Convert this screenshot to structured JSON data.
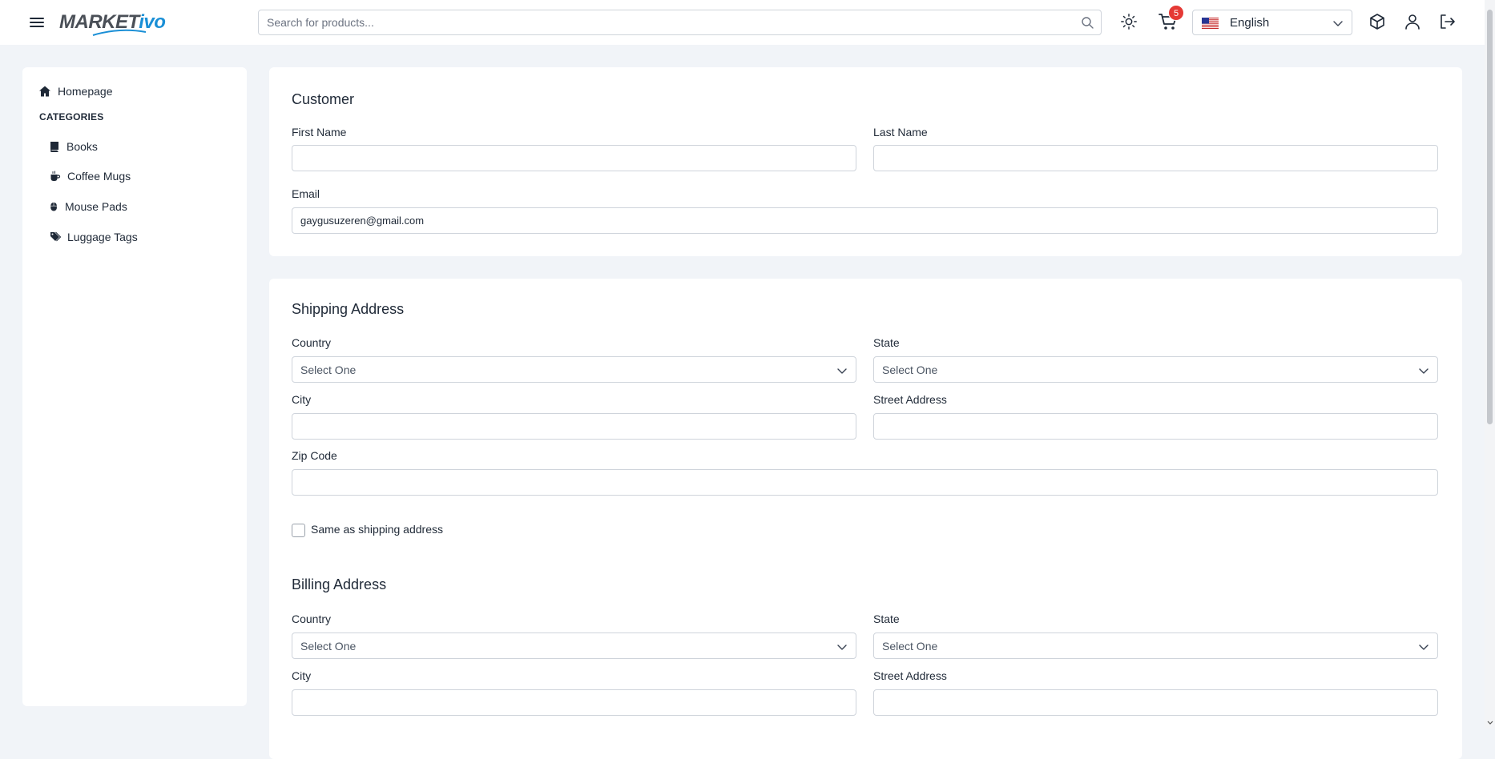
{
  "header": {
    "logo": {
      "part1": "MARKET",
      "part2": "ivo"
    },
    "search": {
      "placeholder": "Search for products..."
    },
    "cart": {
      "badge_count": "5"
    },
    "language": {
      "selected": "English"
    },
    "icons": [
      "menu-icon",
      "search-icon",
      "sun-icon",
      "cart-icon",
      "us-flag-icon",
      "chevron-down-icon",
      "box-icon",
      "user-icon",
      "logout-icon"
    ]
  },
  "sidebar": {
    "home": "Homepage",
    "categories_heading": "CATEGORIES",
    "items": [
      {
        "label": "Books",
        "icon": "book-icon"
      },
      {
        "label": "Coffee Mugs",
        "icon": "mug-icon"
      },
      {
        "label": "Mouse Pads",
        "icon": "mouse-icon"
      },
      {
        "label": "Luggage Tags",
        "icon": "tags-icon"
      }
    ]
  },
  "customer": {
    "title": "Customer",
    "first_name": {
      "label": "First Name",
      "value": ""
    },
    "last_name": {
      "label": "Last Name",
      "value": ""
    },
    "email": {
      "label": "Email",
      "value": "gaygusuzeren@gmail.com"
    }
  },
  "shipping": {
    "title": "Shipping Address",
    "country": {
      "label": "Country",
      "value": "Select One"
    },
    "state": {
      "label": "State",
      "value": "Select One"
    },
    "city": {
      "label": "City",
      "value": ""
    },
    "street": {
      "label": "Street Address",
      "value": ""
    },
    "zip": {
      "label": "Zip Code",
      "value": ""
    },
    "same_checkbox": {
      "label": "Same as shipping address",
      "checked": false
    }
  },
  "billing": {
    "title": "Billing Address",
    "country": {
      "label": "Country",
      "value": "Select One"
    },
    "state": {
      "label": "State",
      "value": "Select One"
    },
    "city": {
      "label": "City",
      "value": ""
    },
    "street": {
      "label": "Street Address",
      "value": ""
    }
  },
  "colors": {
    "page_bg": "#f1f4f8",
    "card_bg": "#ffffff",
    "border": "#cfd4db",
    "brand_blue": "#1a8fd6",
    "badge_red": "#e53935"
  }
}
